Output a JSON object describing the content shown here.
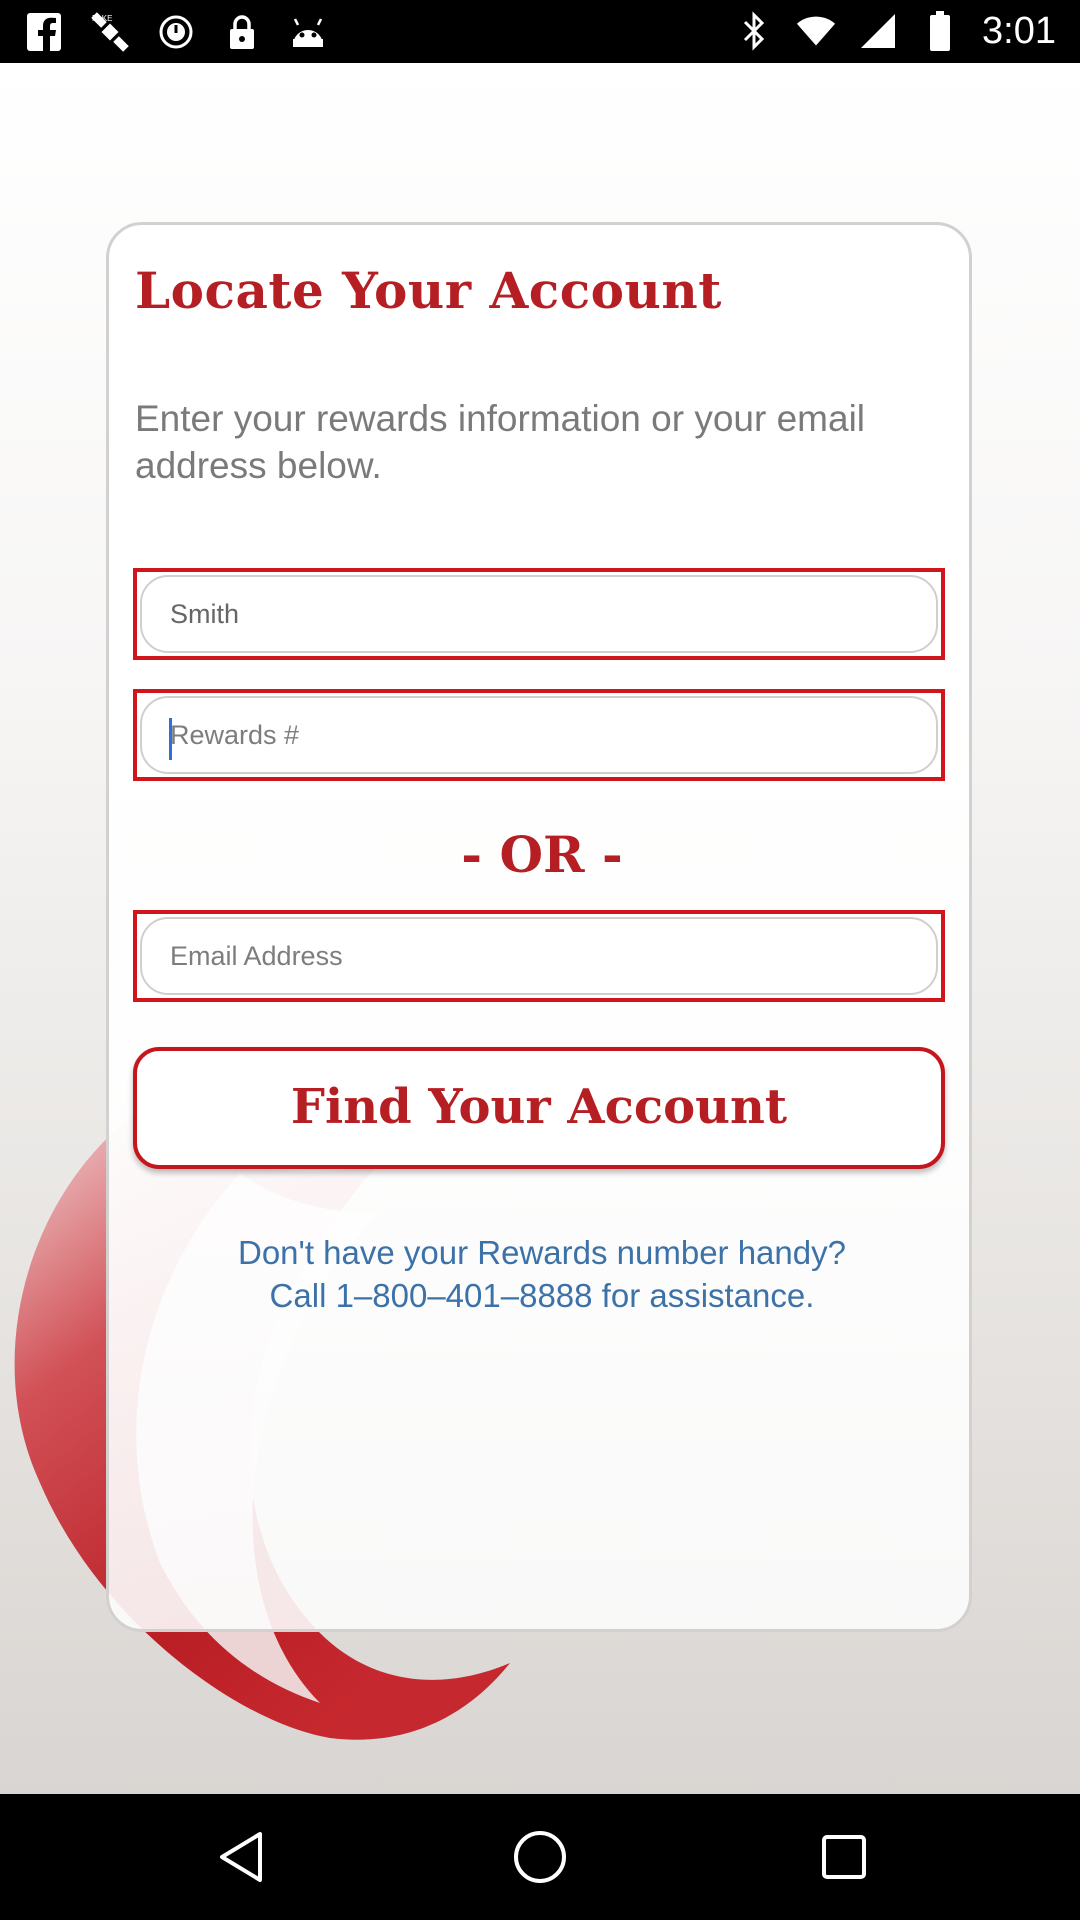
{
  "status_bar": {
    "time": "3:01",
    "left_icons": [
      "facebook-icon",
      "fake-gps-icon",
      "clock-icon",
      "lock-icon",
      "android-icon"
    ],
    "right_icons": [
      "bluetooth-icon",
      "wifi-icon",
      "signal-icon",
      "battery-icon"
    ]
  },
  "card": {
    "title": "Locate Your Account",
    "subtitle": "Enter your rewards information or your email address below.",
    "last_name_value": "Smith",
    "rewards_placeholder": "Rewards #",
    "or_label": "- OR -",
    "email_placeholder": "Email Address",
    "find_button_label": "Find Your Account",
    "help_line1": "Don't have your Rewards number handy?",
    "help_line2": "Call 1–800–401–8888 for assistance."
  },
  "colors": {
    "brand_red": "#b51f24",
    "field_border_red": "#d1161b",
    "link_blue": "#3c72a8",
    "caret_blue": "#2f6fd8"
  },
  "nav_bar": {
    "buttons": [
      "back-icon",
      "home-icon",
      "recents-icon"
    ]
  }
}
